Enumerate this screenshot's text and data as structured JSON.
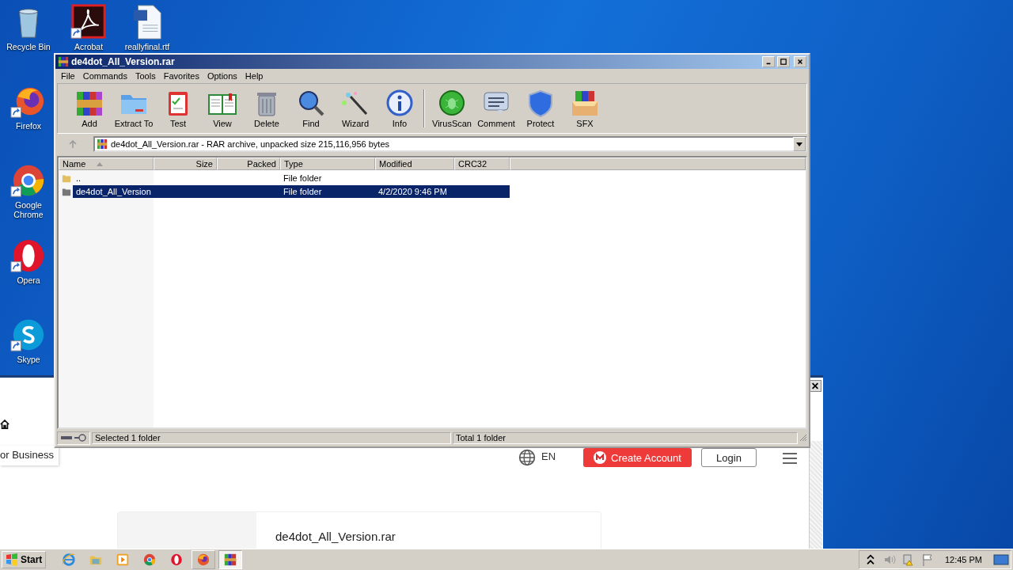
{
  "desktop_icons": [
    {
      "label": "Recycle Bin",
      "kind": "recycle",
      "shortcut": false
    },
    {
      "label": "Acrobat",
      "kind": "acrobat",
      "shortcut": true
    },
    {
      "label": "reallyfinal.rtf",
      "kind": "word",
      "shortcut": false
    },
    {
      "label": "Firefox",
      "kind": "firefox",
      "shortcut": true
    },
    {
      "label": "Google Chrome",
      "kind": "chrome",
      "shortcut": true
    },
    {
      "label": "Opera",
      "kind": "opera",
      "shortcut": true
    },
    {
      "label": "Skype",
      "kind": "skype",
      "shortcut": true
    }
  ],
  "browser": {
    "business_link": "or Business",
    "language": "EN",
    "create_account": "Create Account",
    "login": "Login",
    "file_title": "de4dot_All_Version.rar"
  },
  "window": {
    "title": "de4dot_All_Version.rar",
    "menu": [
      "File",
      "Commands",
      "Tools",
      "Favorites",
      "Options",
      "Help"
    ],
    "toolbar": [
      {
        "label": "Add",
        "kind": "add"
      },
      {
        "label": "Extract To",
        "kind": "extract"
      },
      {
        "label": "Test",
        "kind": "test"
      },
      {
        "label": "View",
        "kind": "view"
      },
      {
        "label": "Delete",
        "kind": "delete"
      },
      {
        "label": "Find",
        "kind": "find"
      },
      {
        "label": "Wizard",
        "kind": "wizard"
      },
      {
        "label": "Info",
        "kind": "info"
      },
      {
        "label": "VirusScan",
        "kind": "virus"
      },
      {
        "label": "Comment",
        "kind": "comment"
      },
      {
        "label": "Protect",
        "kind": "protect"
      },
      {
        "label": "SFX",
        "kind": "sfx"
      }
    ],
    "address": "de4dot_All_Version.rar - RAR archive, unpacked size 215,116,956 bytes",
    "columns": [
      {
        "label": "Name",
        "sorted": true
      },
      {
        "label": "Size",
        "sorted": false
      },
      {
        "label": "Packed",
        "sorted": false
      },
      {
        "label": "Type",
        "sorted": false
      },
      {
        "label": "Modified",
        "sorted": false
      },
      {
        "label": "CRC32",
        "sorted": false
      }
    ],
    "rows": [
      {
        "name": "..",
        "type": "File folder",
        "selected": false
      },
      {
        "name": "de4dot_All_Version",
        "type": "File folder",
        "modified": "4/2/2020 9:46 PM",
        "selected": true
      }
    ],
    "status_left": "Selected 1 folder",
    "status_right": "Total 1 folder"
  },
  "taskbar": {
    "start": "Start",
    "apps": [
      {
        "kind": "ie",
        "running": false,
        "selected": false
      },
      {
        "kind": "explorer",
        "running": false,
        "selected": false
      },
      {
        "kind": "media",
        "running": false,
        "selected": false
      },
      {
        "kind": "chrome",
        "running": false,
        "selected": false
      },
      {
        "kind": "opera",
        "running": false,
        "selected": false
      },
      {
        "kind": "firefox",
        "running": true,
        "selected": false
      },
      {
        "kind": "winrar",
        "running": true,
        "selected": true
      }
    ],
    "clock": "12:45 PM"
  }
}
